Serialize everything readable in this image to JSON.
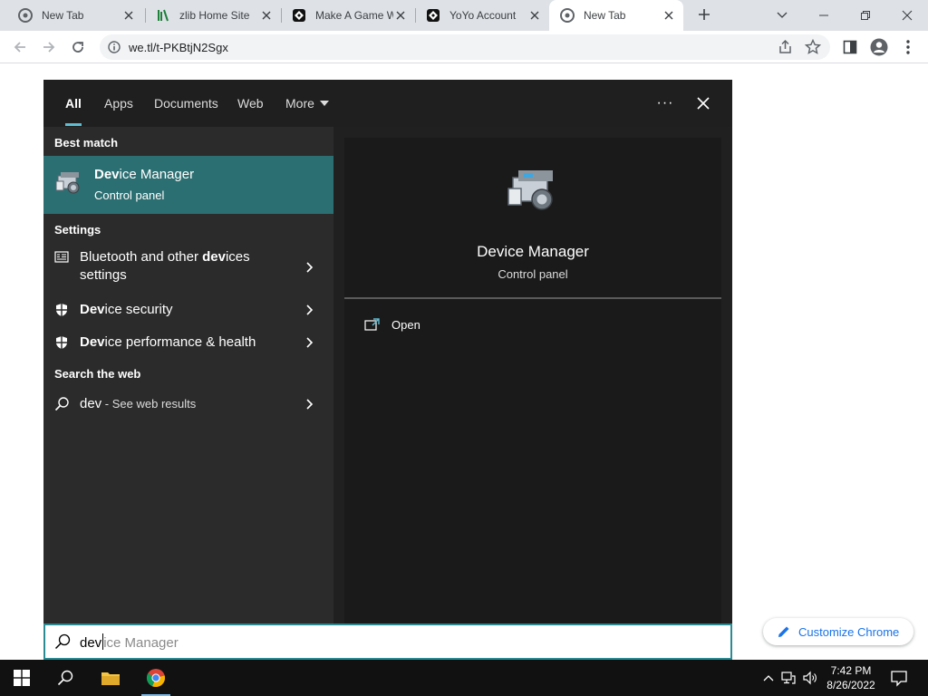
{
  "browser": {
    "tabs": [
      {
        "title": "New Tab",
        "icon": "chrome-icon",
        "active": false
      },
      {
        "title": "zlib Home Site",
        "icon": "zlib-icon",
        "active": false
      },
      {
        "title": "Make A Game W",
        "icon": "yoyo-icon",
        "active": false
      },
      {
        "title": "YoYo Account",
        "icon": "yoyo-icon",
        "active": false
      },
      {
        "title": "New Tab",
        "icon": "chrome-icon",
        "active": true
      }
    ],
    "url": "we.tl/t-PKBtjN2Sgx",
    "customize_label": "Customize Chrome"
  },
  "search_panel": {
    "tabs": [
      "All",
      "Apps",
      "Documents",
      "Web",
      "More"
    ],
    "active_tab": "All",
    "best_match_label": "Best match",
    "best_match": {
      "name_bold": "Dev",
      "name_rest": "ice Manager",
      "subtitle": "Control panel",
      "icon": "device-manager-icon"
    },
    "settings_label": "Settings",
    "settings_results": [
      {
        "pre": "Bluetooth and other ",
        "bold": "dev",
        "post": "ices",
        "line2": "settings",
        "icon": "bluetooth-settings-icon"
      },
      {
        "pre": "",
        "bold": "Dev",
        "post": "ice security",
        "line2": "",
        "icon": "shield-icon"
      },
      {
        "pre": "",
        "bold": "Dev",
        "post": "ice performance & health",
        "line2": "",
        "icon": "shield-icon"
      }
    ],
    "web_label": "Search the web",
    "web_result": {
      "query": "dev",
      "suffix": " - See web results",
      "icon": "search-icon"
    },
    "preview": {
      "title": "Device Manager",
      "subtitle": "Control panel",
      "action": "Open"
    }
  },
  "search_box": {
    "typed": "dev",
    "suggestion": "ice Manager"
  },
  "taskbar": {
    "time": "7:42 PM",
    "date": "8/26/2022",
    "accent": "#76b9ed"
  },
  "colors": {
    "highlight": "#2c6f72",
    "search_border": "#2b8a92",
    "tab_underline": "#5fbcd3",
    "link_blue": "#1a73e8"
  }
}
